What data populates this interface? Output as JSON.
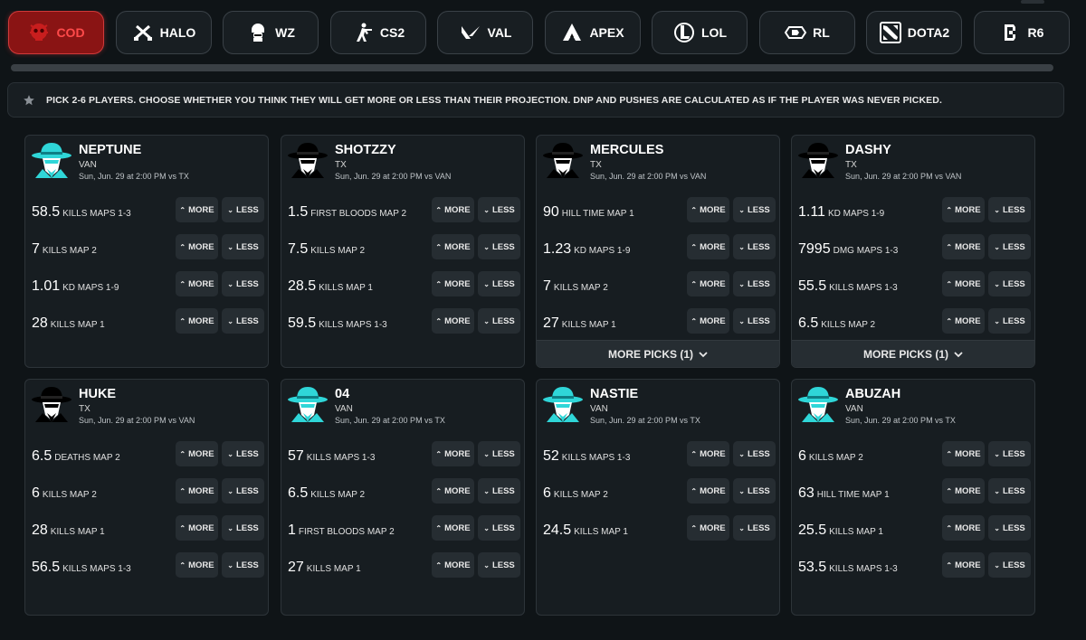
{
  "tabs": [
    {
      "label": "COD",
      "icon": "cod-skull-icon",
      "active": true
    },
    {
      "label": "HALO",
      "icon": "halo-crossed-guns-icon",
      "active": false
    },
    {
      "label": "WZ",
      "icon": "warzone-soldier-icon",
      "active": false
    },
    {
      "label": "CS2",
      "icon": "cs2-soldier-icon",
      "active": false
    },
    {
      "label": "VAL",
      "icon": "valorant-logo-icon",
      "active": false
    },
    {
      "label": "APEX",
      "icon": "apex-logo-icon",
      "active": false
    },
    {
      "label": "LOL",
      "icon": "lol-logo-icon",
      "active": false
    },
    {
      "label": "RL",
      "icon": "rocket-league-logo-icon",
      "active": false
    },
    {
      "label": "DOTA2",
      "icon": "dota2-logo-icon",
      "active": false
    },
    {
      "label": "R6",
      "icon": "r6-logo-icon",
      "active": false
    }
  ],
  "notice": {
    "icon": "star-icon",
    "text": "PICK 2-6 PLAYERS. CHOOSE WHETHER YOU THINK THEY WILL GET MORE OR LESS THAN THEIR PROJECTION. DNP AND PUSHES ARE CALCULATED AS IF THE PLAYER WAS NEVER PICKED."
  },
  "labels": {
    "more": "MORE",
    "less": "LESS"
  },
  "colors": {
    "van": "#2fd6d8",
    "tx": "#000000",
    "active_tab": "#8a1414",
    "active_text": "#ff4a4a"
  },
  "players": [
    {
      "name": "NEPTUNE",
      "team": "VAN",
      "game": "Sun, Jun. 29 at 2:00 PM vs TX",
      "avatar": "van",
      "props": [
        {
          "value": "58.5",
          "stat": "KILLS MAPS 1-3"
        },
        {
          "value": "7",
          "stat": "KILLS MAP 2"
        },
        {
          "value": "1.01",
          "stat": "KD MAPS 1-9"
        },
        {
          "value": "28",
          "stat": "KILLS MAP 1"
        }
      ],
      "more_picks": ""
    },
    {
      "name": "SHOTZZY",
      "team": "TX",
      "game": "Sun, Jun. 29 at 2:00 PM vs VAN",
      "avatar": "tx",
      "props": [
        {
          "value": "1.5",
          "stat": "FIRST BLOODS MAP 2"
        },
        {
          "value": "7.5",
          "stat": "KILLS MAP 2"
        },
        {
          "value": "28.5",
          "stat": "KILLS MAP 1"
        },
        {
          "value": "59.5",
          "stat": "KILLS MAPS 1-3"
        }
      ],
      "more_picks": ""
    },
    {
      "name": "MERCULES",
      "team": "TX",
      "game": "Sun, Jun. 29 at 2:00 PM vs VAN",
      "avatar": "tx",
      "props": [
        {
          "value": "90",
          "stat": "HILL TIME MAP 1"
        },
        {
          "value": "1.23",
          "stat": "KD MAPS 1-9"
        },
        {
          "value": "7",
          "stat": "KILLS MAP 2"
        },
        {
          "value": "27",
          "stat": "KILLS MAP 1"
        }
      ],
      "more_picks": "MORE PICKS (1)"
    },
    {
      "name": "DASHY",
      "team": "TX",
      "game": "Sun, Jun. 29 at 2:00 PM vs VAN",
      "avatar": "tx",
      "props": [
        {
          "value": "1.11",
          "stat": "KD MAPS 1-9"
        },
        {
          "value": "7995",
          "stat": "DMG MAPS 1-3"
        },
        {
          "value": "55.5",
          "stat": "KILLS MAPS 1-3"
        },
        {
          "value": "6.5",
          "stat": "KILLS MAP 2"
        }
      ],
      "more_picks": "MORE PICKS (1)"
    },
    {
      "name": "HUKE",
      "team": "TX",
      "game": "Sun, Jun. 29 at 2:00 PM vs VAN",
      "avatar": "tx",
      "props": [
        {
          "value": "6.5",
          "stat": "DEATHS MAP 2"
        },
        {
          "value": "6",
          "stat": "KILLS MAP 2"
        },
        {
          "value": "28",
          "stat": "KILLS MAP 1"
        },
        {
          "value": "56.5",
          "stat": "KILLS MAPS 1-3"
        }
      ],
      "more_picks": ""
    },
    {
      "name": "04",
      "team": "VAN",
      "game": "Sun, Jun. 29 at 2:00 PM vs TX",
      "avatar": "van",
      "props": [
        {
          "value": "57",
          "stat": "KILLS MAPS 1-3"
        },
        {
          "value": "6.5",
          "stat": "KILLS MAP 2"
        },
        {
          "value": "1",
          "stat": "FIRST BLOODS MAP 2"
        },
        {
          "value": "27",
          "stat": "KILLS MAP 1"
        }
      ],
      "more_picks": ""
    },
    {
      "name": "NASTIE",
      "team": "VAN",
      "game": "Sun, Jun. 29 at 2:00 PM vs TX",
      "avatar": "van",
      "props": [
        {
          "value": "52",
          "stat": "KILLS MAPS 1-3"
        },
        {
          "value": "6",
          "stat": "KILLS MAP 2"
        },
        {
          "value": "24.5",
          "stat": "KILLS MAP 1"
        }
      ],
      "more_picks": ""
    },
    {
      "name": "ABUZAH",
      "team": "VAN",
      "game": "Sun, Jun. 29 at 2:00 PM vs TX",
      "avatar": "van",
      "props": [
        {
          "value": "6",
          "stat": "KILLS MAP 2"
        },
        {
          "value": "63",
          "stat": "HILL TIME MAP 1"
        },
        {
          "value": "25.5",
          "stat": "KILLS MAP 1"
        },
        {
          "value": "53.5",
          "stat": "KILLS MAPS 1-3"
        }
      ],
      "more_picks": ""
    }
  ]
}
